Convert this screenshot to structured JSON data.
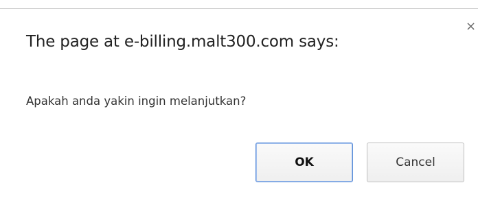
{
  "dialog": {
    "title": "The page at e-billing.malt300.com says:",
    "message": "Apakah anda yakin ingin melanjutkan?",
    "close_glyph": "×",
    "close_icon": "close-icon",
    "ok_label": "OK",
    "cancel_label": "Cancel"
  },
  "colors": {
    "ok_border": "#5d8fd9",
    "button_border": "#bdbdbd",
    "text": "#222222"
  }
}
